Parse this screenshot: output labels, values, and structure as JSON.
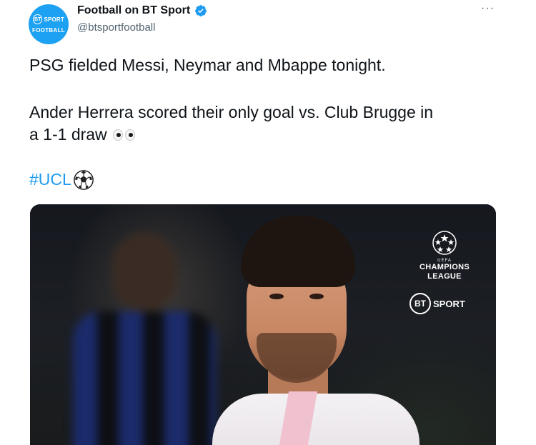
{
  "tweet": {
    "display_name": "Football on BT Sport",
    "handle": "@btsportfootball",
    "avatar": {
      "bt": "BT",
      "sport": "SPORT",
      "sub": "FOOTBALL",
      "color": "#1da1f2"
    },
    "verified_icon": "verified-badge-icon",
    "more_label": "···",
    "text_line1": "PSG fielded Messi, Neymar and Mbappe tonight.",
    "text_line2": "Ander Herrera scored their only goal vs. Club Brugge in",
    "text_line3": "a 1-1 draw",
    "eyes_emoji": "eyes-emoji-icon",
    "hashtag": "#UCL",
    "hashtag_emoji": "soccer-ball-icon",
    "link_color": "#1d9bf0"
  },
  "media": {
    "ucl_small": "UEFA",
    "ucl_line1": "CHAMPIONS",
    "ucl_line2": "LEAGUE",
    "bt_mark": "BT",
    "bt_word": "SPORT"
  }
}
